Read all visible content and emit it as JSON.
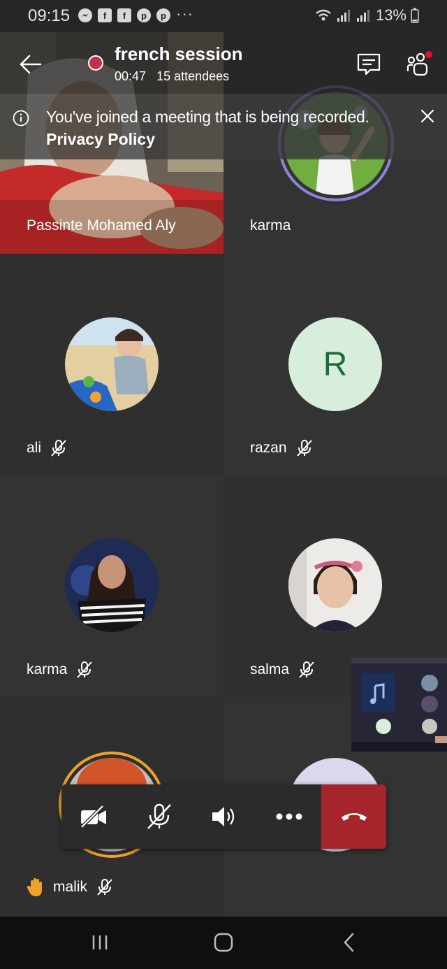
{
  "status_bar": {
    "time": "09:15",
    "notification_icons": [
      "messenger-icon",
      "facebook-icon",
      "facebook-icon",
      "pinterest-icon",
      "pinterest-icon"
    ],
    "more_indicator": "···",
    "battery_percent": "13%"
  },
  "meeting": {
    "title": "french session",
    "duration": "00:47",
    "attendees": "15 attendees",
    "recording_color": "#c4314b"
  },
  "banner": {
    "message": "You've joined a meeting that is being recorded.",
    "link_label": "Privacy Policy"
  },
  "participants": [
    {
      "name": "Passinte Mohamed Aly",
      "muted": false
    },
    {
      "name": "karma",
      "muted": false
    },
    {
      "name": "ali",
      "muted": true
    },
    {
      "name": "razan",
      "muted": true,
      "initial": "R"
    },
    {
      "name": "karma",
      "muted": true
    },
    {
      "name": "salma",
      "muted": true
    },
    {
      "name": "malik",
      "muted": true,
      "hand_raised": true
    }
  ],
  "controls": [
    "video-off-icon",
    "mic-off-icon",
    "speaker-icon",
    "more-icon",
    "hangup-icon"
  ],
  "colors": {
    "hangup": "#a4262c",
    "avatar_r_bg": "#d7eedd",
    "avatar_r_text": "#1d6b3a",
    "raise_hand": "#f0a12c"
  }
}
